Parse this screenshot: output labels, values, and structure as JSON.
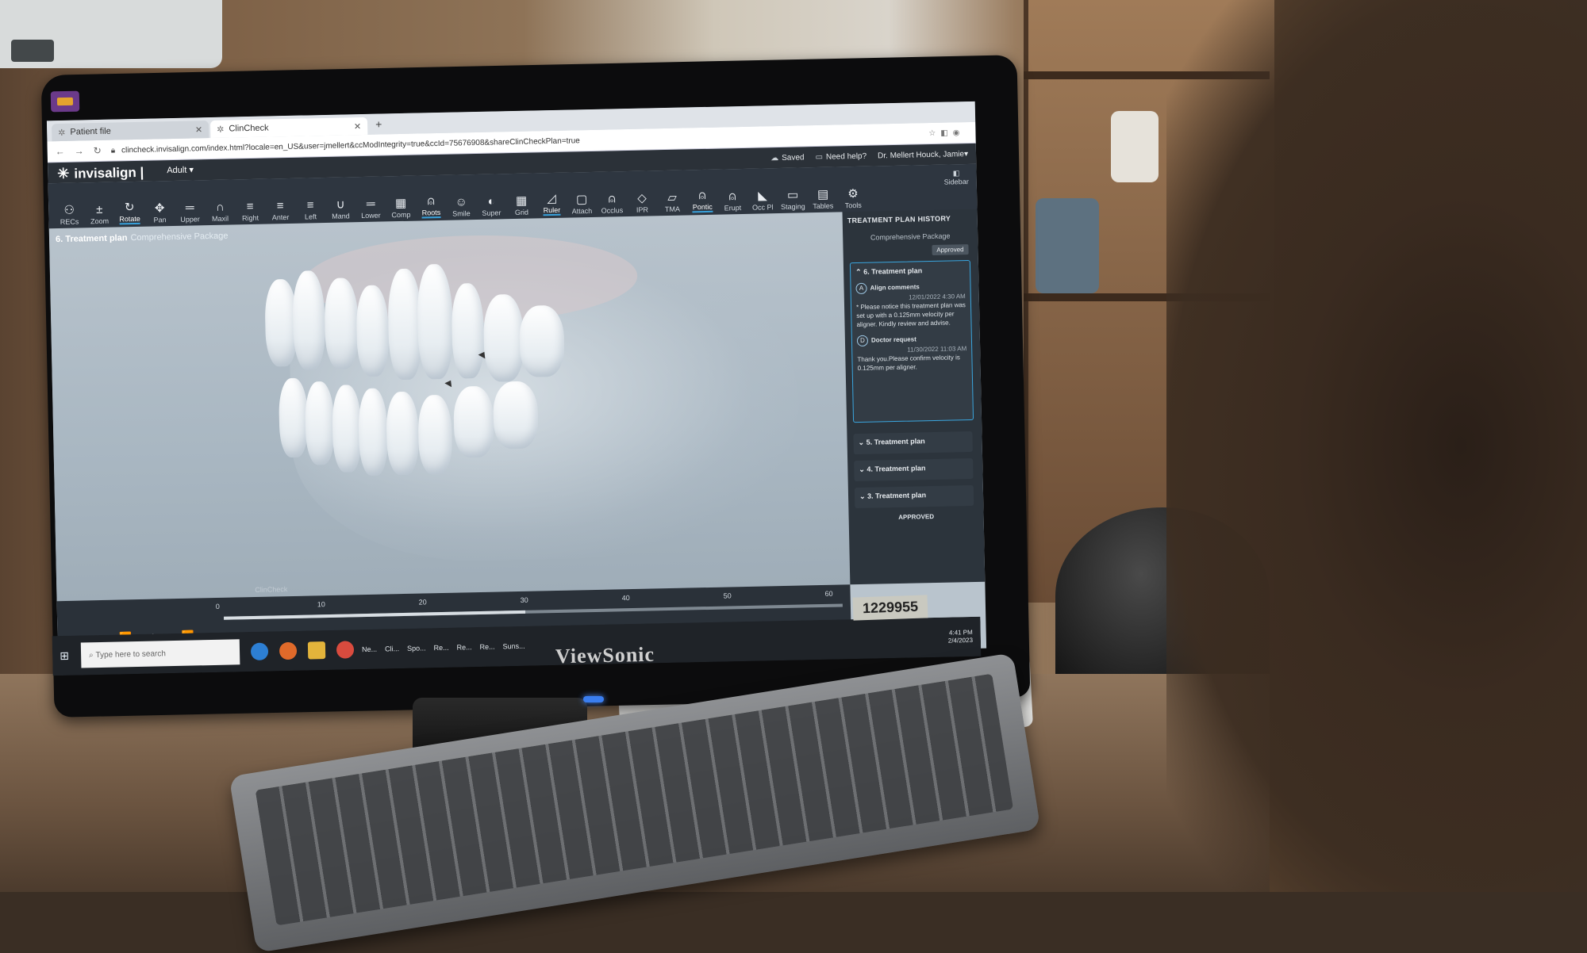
{
  "browser": {
    "tabs": [
      {
        "label": "Patient file"
      },
      {
        "label": "ClinCheck"
      }
    ],
    "new_tab": "+",
    "url": "clincheck.invisalign.com/index.html?locale=en_US&user=jmellert&ccModIntegrity=true&ccId=75676908&shareClinCheckPlan=true"
  },
  "appbar": {
    "saved": "Saved",
    "help": "Need help?",
    "user": "Dr. Mellert Houck, Jamie"
  },
  "app": {
    "logo": "invisalign",
    "mode": "Adult"
  },
  "toolbar": {
    "tools": [
      {
        "label": "RECs",
        "icon": "person-icon"
      },
      {
        "label": "Zoom",
        "icon": "zoom-icon"
      },
      {
        "label": "Rotate",
        "icon": "rotate-icon",
        "selected": true
      },
      {
        "label": "Pan",
        "icon": "pan-icon"
      },
      {
        "label": "Upper",
        "icon": "upper-icon"
      },
      {
        "label": "Maxil",
        "icon": "maxil-icon"
      },
      {
        "label": "Right",
        "icon": "right-icon"
      },
      {
        "label": "Anter",
        "icon": "anterior-icon"
      },
      {
        "label": "Left",
        "icon": "left-icon"
      },
      {
        "label": "Mand",
        "icon": "mandible-icon"
      },
      {
        "label": "Lower",
        "icon": "lower-icon"
      },
      {
        "label": "Comp",
        "icon": "compare-icon"
      },
      {
        "label": "Roots",
        "icon": "roots-icon",
        "selected": true
      },
      {
        "label": "Smile",
        "icon": "smile-icon"
      },
      {
        "label": "Super",
        "icon": "superimpose-icon"
      },
      {
        "label": "Grid",
        "icon": "grid-icon"
      },
      {
        "label": "Ruler",
        "icon": "ruler-icon",
        "selected": true
      },
      {
        "label": "Attach",
        "icon": "attach-icon"
      },
      {
        "label": "Occlus",
        "icon": "occlusion-icon"
      },
      {
        "label": "IPR",
        "icon": "ipr-icon"
      },
      {
        "label": "TMA",
        "icon": "tma-icon"
      },
      {
        "label": "Pontic",
        "icon": "pontic-icon",
        "selected": true
      },
      {
        "label": "Erupt",
        "icon": "erupt-icon"
      },
      {
        "label": "Occ Pl",
        "icon": "occlusal-plane-icon"
      },
      {
        "label": "Staging",
        "icon": "staging-icon"
      },
      {
        "label": "Tables",
        "icon": "tables-icon"
      },
      {
        "label": "Tools",
        "icon": "tools-icon"
      }
    ],
    "sidebar": "Sidebar"
  },
  "viewport": {
    "title": "6. Treatment plan",
    "subtitle": "Comprehensive Package",
    "watermark": "ClinCheck"
  },
  "history": {
    "heading": "TREATMENT PLAN HISTORY",
    "package": "Comprehensive Package",
    "status": "Approved",
    "open_plan": {
      "title": "6. Treatment plan",
      "comments": [
        {
          "avatar": "A",
          "who": "Align comments",
          "time": "12/01/2022 4:30 AM",
          "text": "* Please notice this treatment plan was set up with a 0.125mm velocity per aligner. Kindly review and advise."
        },
        {
          "avatar": "D",
          "who": "Doctor request",
          "time": "11/30/2022 11:03 AM",
          "text": "Thank you.Please confirm velocity is 0.125mm per aligner."
        }
      ]
    },
    "closed_plans": [
      "5. Treatment plan",
      "4. Treatment plan",
      "3. Treatment plan"
    ],
    "approved_label": "APPROVED"
  },
  "timeline": {
    "ticks": [
      "0",
      "10",
      "20",
      "30",
      "40",
      "50",
      "60"
    ]
  },
  "taskbar": {
    "search_placeholder": "Type here to search",
    "apps": [
      "Ne...",
      "Cli...",
      "Spo...",
      "Re...",
      "Re...",
      "Re...",
      "Suns..."
    ],
    "clock": "4:41 PM",
    "date": "2/4/2023"
  },
  "monitor": {
    "brand": "ViewSonic",
    "asset_tag": "1229955"
  },
  "colors": {
    "toolbar_bg": "#2e3640",
    "accent": "#38a1db",
    "viewport_bg": "#b8c3cc"
  }
}
